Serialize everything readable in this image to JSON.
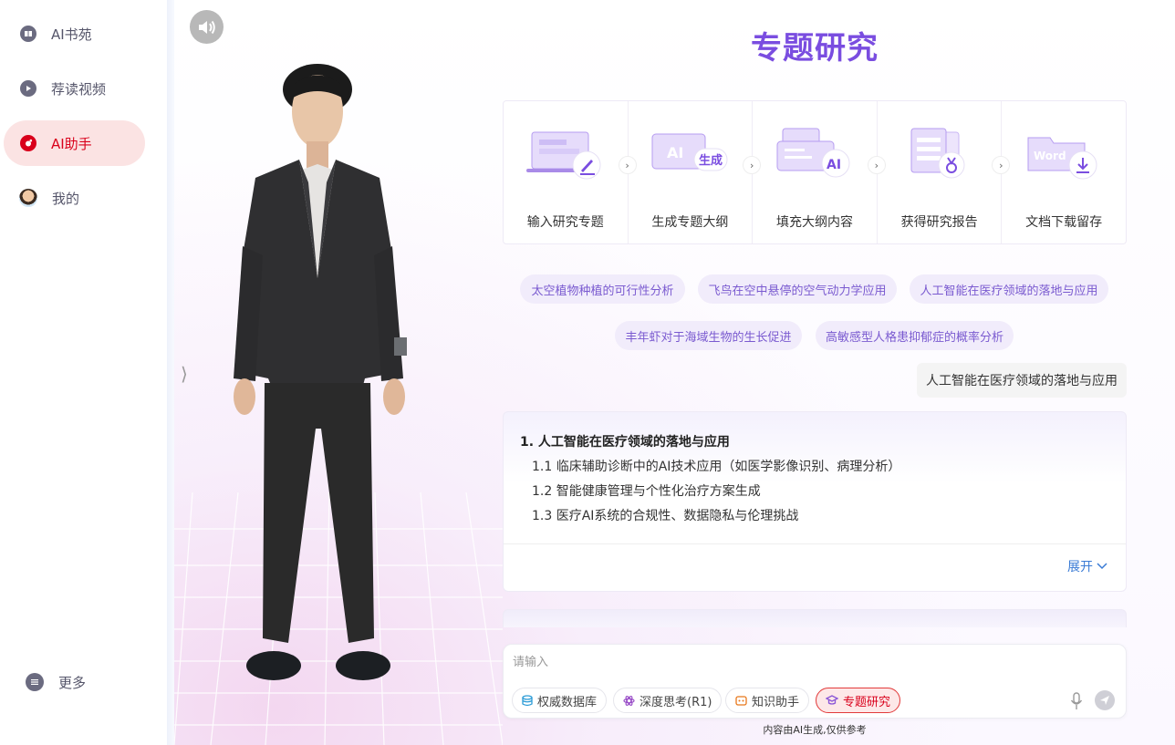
{
  "sidebar": {
    "items": [
      {
        "label": "AI书苑",
        "icon": "book-icon"
      },
      {
        "label": "荐读视频",
        "icon": "play-icon"
      },
      {
        "label": "AI助手",
        "icon": "assistant-icon",
        "active": true
      },
      {
        "label": "我的",
        "icon": "avatar-icon"
      }
    ],
    "more_label": "更多"
  },
  "page": {
    "title": "专题研究"
  },
  "steps": [
    {
      "label": "输入研究专题",
      "icon": "laptop-pen-icon"
    },
    {
      "label": "生成专题大纲",
      "icon": "ai-generate-icon",
      "badge_text": "生成",
      "ai_text": "AI"
    },
    {
      "label": "填充大纲内容",
      "icon": "ai-fill-icon",
      "ai_text": "AI"
    },
    {
      "label": "获得研究报告",
      "icon": "report-medal-icon"
    },
    {
      "label": "文档下载留存",
      "icon": "word-download-icon",
      "word_text": "Word"
    }
  ],
  "suggestions": [
    "太空植物种植的可行性分析",
    "飞鸟在空中悬停的空气动力学应用",
    "人工智能在医疗领域的落地与应用",
    "丰年虾对于海域生物的生长促进",
    "高敏感型人格患抑郁症的概率分析"
  ],
  "conversation": {
    "user_message": "人工智能在医疗领域的落地与应用",
    "answer": {
      "heading": "1. 人工智能在医疗领域的落地与应用",
      "items": [
        "1.1 临床辅助诊断中的AI技术应用（如医学影像识别、病理分析）",
        "1.2 智能健康管理与个性化治疗方案生成",
        "1.3 医疗AI系统的合规性、数据隐私与伦理挑战"
      ],
      "expand_label": "展开"
    }
  },
  "input": {
    "placeholder": "请输入",
    "tools": [
      {
        "label": "权威数据库",
        "icon": "database-icon"
      },
      {
        "label": "深度思考(R1)",
        "icon": "atom-icon"
      },
      {
        "label": "知识助手",
        "icon": "knowledge-icon"
      },
      {
        "label": "专题研究",
        "icon": "graduation-cap-icon",
        "active": true
      }
    ]
  },
  "disclaimer": "内容由AI生成,仅供参考",
  "colors": {
    "brand_purple": "#7a4de0",
    "active_red": "#d9001b",
    "active_bg": "#fbe3e3",
    "chip_bg": "#f1ecfb",
    "link_blue": "#3a7bd5"
  }
}
